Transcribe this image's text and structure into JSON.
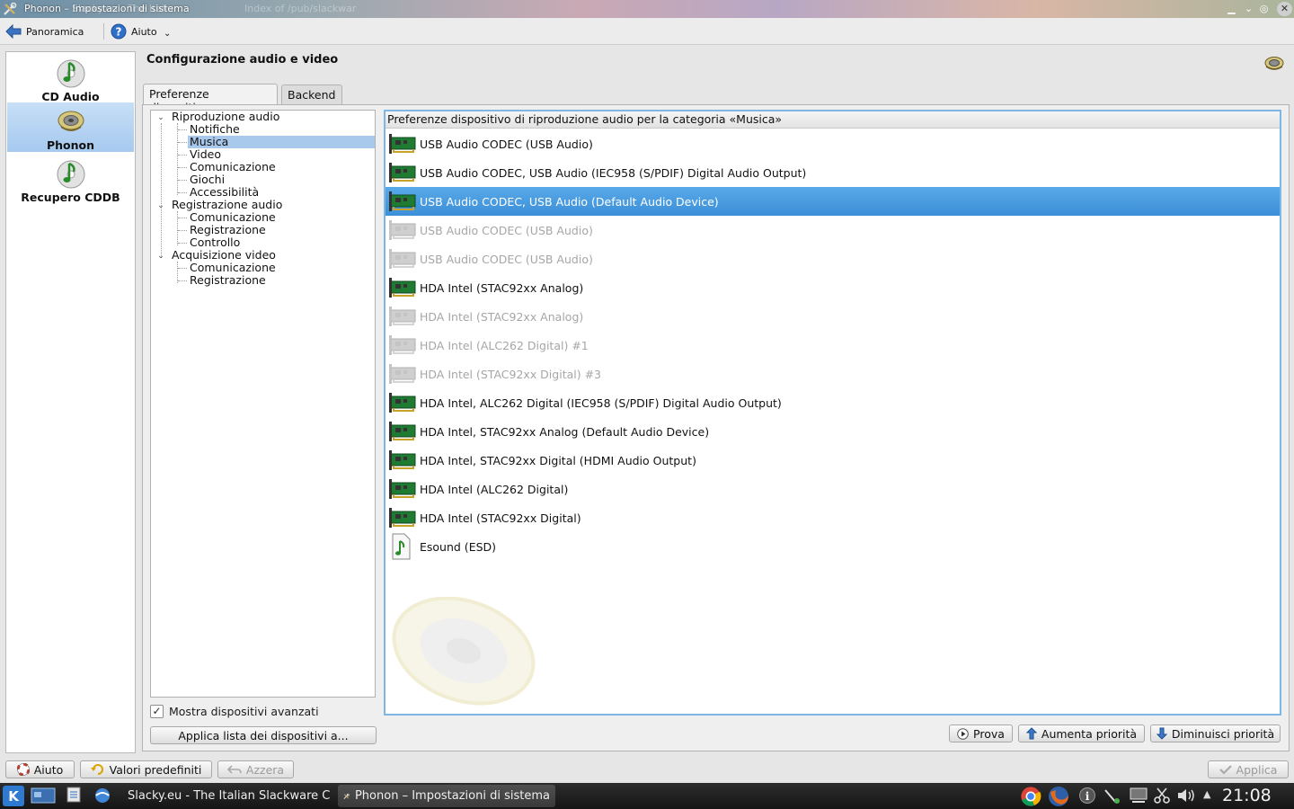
{
  "window": {
    "title": "Phonon – Impostazioni di sistema",
    "background_tabs": [
      "Slacky.eu - The Italian",
      "Index of /pub/slackwar"
    ]
  },
  "toolbar": {
    "overview_label": "Panoramica",
    "help_label": "Aiuto"
  },
  "sidebar": {
    "items": [
      {
        "label": "CD Audio",
        "icon": "cd-music-icon"
      },
      {
        "label": "Phonon",
        "icon": "speaker-icon"
      },
      {
        "label": "Recupero CDDB",
        "icon": "cd-music-icon"
      }
    ],
    "selected": "Phonon"
  },
  "content": {
    "title": "Configurazione audio e video"
  },
  "tabs": [
    {
      "label": "Preferenze dispositivo",
      "active": true
    },
    {
      "label": "Backend",
      "active": false
    }
  ],
  "tree": {
    "groups": [
      {
        "label": "Riproduzione audio",
        "children": [
          "Notifiche",
          "Musica",
          "Video",
          "Comunicazione",
          "Giochi",
          "Accessibilità"
        ]
      },
      {
        "label": "Registrazione audio",
        "children": [
          "Comunicazione",
          "Registrazione",
          "Controllo"
        ]
      },
      {
        "label": "Acquisizione video",
        "children": [
          "Comunicazione",
          "Registrazione"
        ]
      }
    ],
    "selected": "Musica"
  },
  "advanced_checkbox": {
    "label": "Mostra dispositivi avanzati",
    "checked": true
  },
  "apply_list_button": "Applica lista dei dispositivi a...",
  "device_list": {
    "header": "Preferenze dispositivo di riproduzione audio per la categoria «Musica»",
    "devices": [
      {
        "name": "USB Audio CODEC (USB Audio)",
        "state": "normal"
      },
      {
        "name": "USB Audio CODEC, USB Audio (IEC958 (S/PDIF) Digital Audio Output)",
        "state": "normal"
      },
      {
        "name": "USB Audio CODEC, USB Audio (Default Audio Device)",
        "state": "selected"
      },
      {
        "name": "USB Audio CODEC (USB Audio)",
        "state": "disabled"
      },
      {
        "name": "USB Audio CODEC (USB Audio)",
        "state": "disabled"
      },
      {
        "name": "HDA Intel (STAC92xx Analog)",
        "state": "normal"
      },
      {
        "name": "HDA Intel (STAC92xx Analog)",
        "state": "disabled"
      },
      {
        "name": "HDA Intel (ALC262 Digital) #1",
        "state": "disabled"
      },
      {
        "name": "HDA Intel (STAC92xx Digital) #3",
        "state": "disabled"
      },
      {
        "name": "HDA Intel, ALC262 Digital (IEC958 (S/PDIF) Digital Audio Output)",
        "state": "normal"
      },
      {
        "name": "HDA Intel, STAC92xx Analog (Default Audio Device)",
        "state": "normal"
      },
      {
        "name": "HDA Intel, STAC92xx Digital (HDMI Audio Output)",
        "state": "normal"
      },
      {
        "name": "HDA Intel (ALC262 Digital)",
        "state": "normal"
      },
      {
        "name": "HDA Intel (STAC92xx Digital)",
        "state": "normal"
      },
      {
        "name": "Esound (ESD)",
        "state": "normal",
        "icon": "audio-file-icon"
      }
    ]
  },
  "list_buttons": {
    "test": "Prova",
    "raise": "Aumenta priorità",
    "lower": "Diminuisci priorità"
  },
  "bottom_buttons": {
    "help": "Aiuto",
    "defaults": "Valori predefiniti",
    "reset": "Azzera",
    "apply": "Applica"
  },
  "taskbar": {
    "tasks": [
      {
        "label": "Slacky.eu - The Italian Slackware C",
        "icon": "chrome-icon"
      },
      {
        "label": "Phonon – Impostazioni di sistema",
        "icon": "tools-icon",
        "active": true
      }
    ],
    "clock": "21:08"
  },
  "colors": {
    "selection": "#3d8fd8",
    "sidebar_selection": "#a6c9ef",
    "taskbar": "#1c1c1c"
  }
}
